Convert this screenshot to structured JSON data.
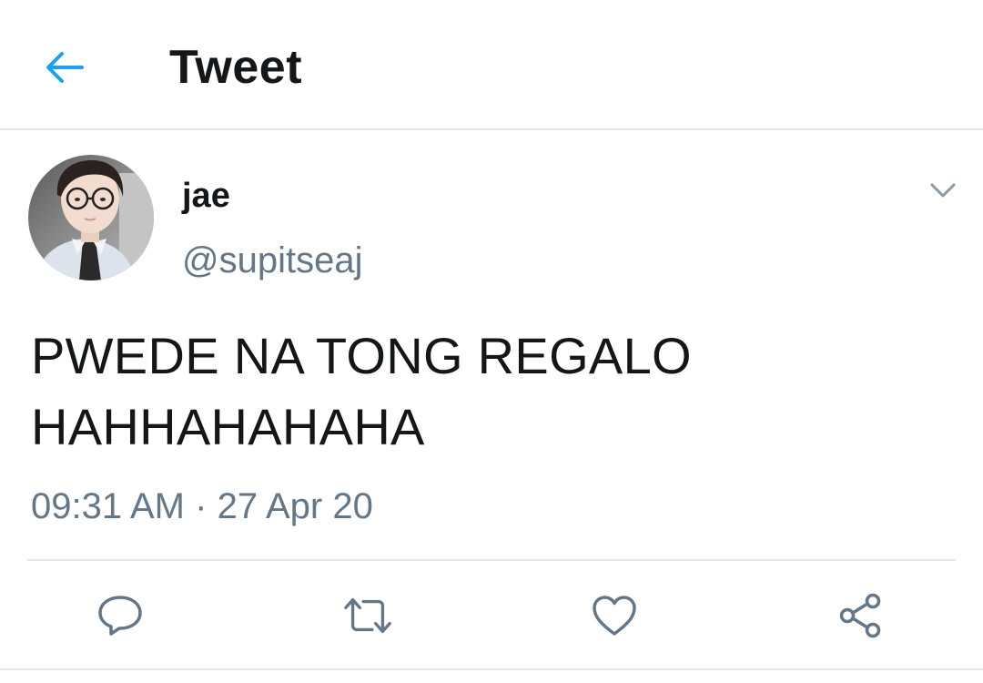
{
  "header": {
    "title": "Tweet",
    "back_icon": "arrow-left-icon",
    "accent_color": "#1da1f2"
  },
  "tweet": {
    "display_name": "jae",
    "handle": "@supitseaj",
    "text_line1": "PWEDE NA TONG REGALO",
    "text_line2": "HAHHAHAHAHA",
    "time": "09:31 AM",
    "separator": "·",
    "date": "27 Apr 20",
    "more_icon": "chevron-down-icon"
  },
  "actions": [
    {
      "icon": "reply-icon"
    },
    {
      "icon": "retweet-icon"
    },
    {
      "icon": "like-icon"
    },
    {
      "icon": "share-icon"
    }
  ],
  "colors": {
    "text_primary": "#14171a",
    "text_secondary": "#657786",
    "divider": "#e1e8ed",
    "icon_gray": "#657786"
  }
}
